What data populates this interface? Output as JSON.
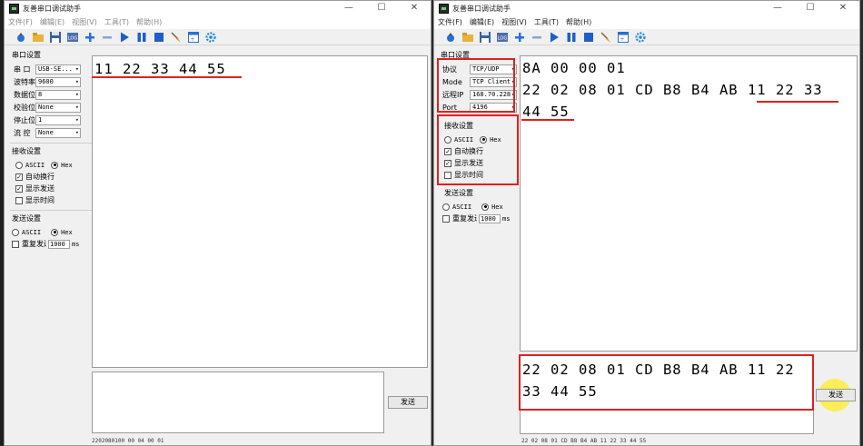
{
  "app": {
    "title": "友善串口调试助手",
    "menus": [
      "文件(F)",
      "编辑(E)",
      "视图(V)",
      "工具(T)",
      "帮助(H)"
    ],
    "send_label": "发送"
  },
  "left": {
    "serial_settings_title": "串口设置",
    "fields": [
      {
        "label": "串  口",
        "value": "USB-SE..."
      },
      {
        "label": "波特率",
        "value": "9600"
      },
      {
        "label": "数据位",
        "value": "8"
      },
      {
        "label": "校验位",
        "value": "None"
      },
      {
        "label": "停止位",
        "value": "1"
      },
      {
        "label": "流  控",
        "value": "None"
      }
    ],
    "recv_title": "接收设置",
    "recv_ascii": "ASCII",
    "recv_hex": "Hex",
    "recv_opts": [
      "自动换行",
      "显示发送",
      "显示时间"
    ],
    "send_title": "发送设置",
    "send_ascii": "ASCII",
    "send_hex": "Hex",
    "repeat_label": "重复发送",
    "repeat_value": "1000",
    "repeat_unit": "ms",
    "recv_text": "11 22 33 44 55",
    "status": "2202080100 00 04 00 01"
  },
  "right": {
    "serial_settings_title": "串口设置",
    "fields": [
      {
        "label": "协议",
        "value": "TCP/UDP"
      },
      {
        "label": "Mode",
        "value": "TCP Client"
      },
      {
        "label": "远程IP",
        "value": "168.70.228"
      },
      {
        "label": "Port",
        "value": "4196"
      }
    ],
    "recv_title": "接收设置",
    "recv_ascii": "ASCII",
    "recv_hex": "Hex",
    "recv_opts": [
      "自动换行",
      "显示发送",
      "显示时间"
    ],
    "send_title": "发送设置",
    "send_ascii": "ASCII",
    "send_hex": "Hex",
    "repeat_label": "重复发送",
    "repeat_value": "1000",
    "repeat_unit": "ms",
    "recv_lines": [
      "8A 00 00 01",
      "22 02 08 01 CD B8 B4 AB 11 22 33",
      "44 55"
    ],
    "send_lines": [
      "22 02 08 01 CD B8 B4 AB 11 22",
      "33 44 55"
    ],
    "status": "22 02 08 01 CD B8 B4 AB 11 22 33 44 55"
  },
  "colors": {
    "highlight": "#e02020",
    "cursor": "#ffec3c"
  }
}
